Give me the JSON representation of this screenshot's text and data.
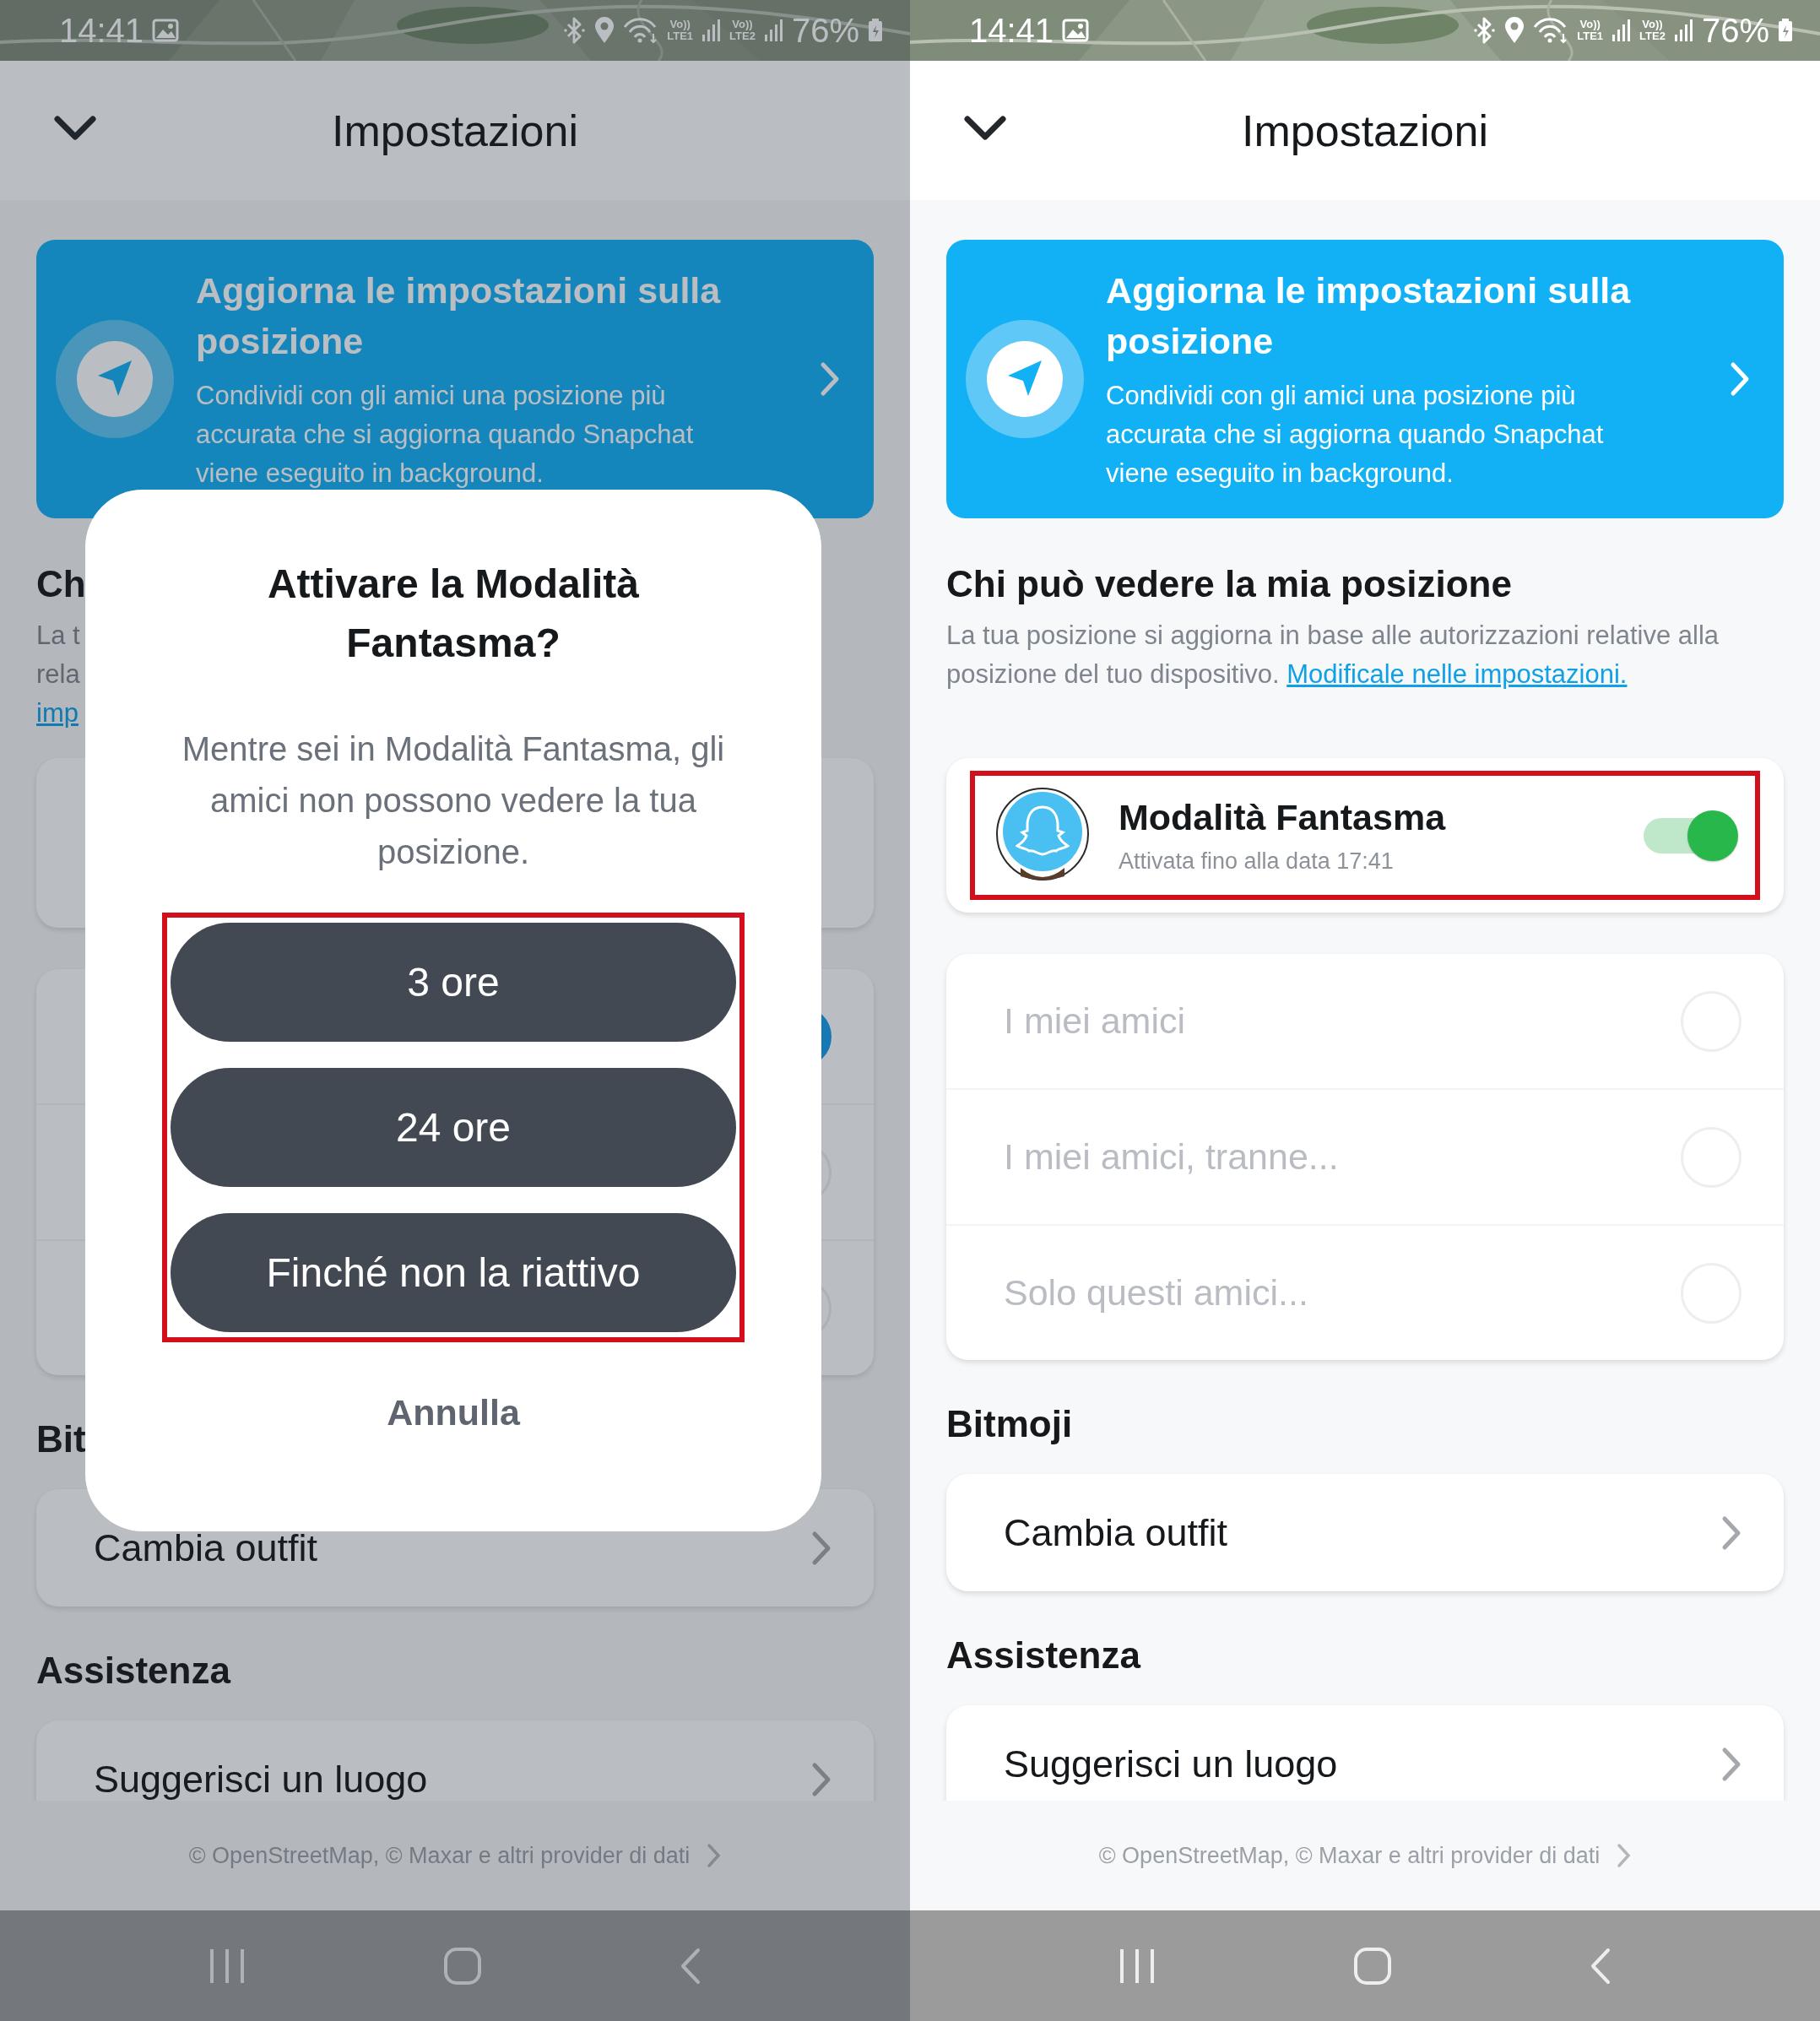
{
  "phones": [
    {
      "kind": "behind_dialog",
      "status_bar": {
        "time": "14:41",
        "sims": [
          {
            "voice": "Vo))",
            "network": "LTE1"
          },
          {
            "voice": "Vo))",
            "network": "LTE2"
          }
        ],
        "battery": "76%"
      },
      "header": {
        "title": "Impostazioni"
      },
      "banner": {
        "title": "Aggiorna le impostazioni sulla posizione",
        "body": "Condividi con gli amici una posizione più accurata che si aggiorna quando Snapchat viene eseguito in background."
      },
      "visibility": {
        "heading": "Ch",
        "description_fragments": [
          {
            "text": "La t",
            "kind": "plain"
          },
          {
            "text": "rela",
            "kind": "plain"
          },
          {
            "text": "imp",
            "kind": "link"
          }
        ],
        "options": [
          {
            "selected": true
          },
          {
            "selected": false
          },
          {
            "selected": false
          }
        ]
      },
      "bitmoji": {
        "heading": "Bit",
        "item": "Cambia outfit"
      },
      "support": {
        "heading": "Assistenza",
        "item": "Suggerisci un luogo"
      },
      "attribution": "© OpenStreetMap, © Maxar e altri provider di dati",
      "dialog": {
        "title": "Attivare la Modalità Fantasma?",
        "message": "Mentre sei in Modalità Fantasma, gli amici non possono vedere la tua posizione.",
        "options_highlighted": true,
        "options": [
          {
            "label": "3 ore"
          },
          {
            "label": "24 ore"
          },
          {
            "label": "Finché non la riattivo"
          }
        ],
        "cancel": "Annulla"
      }
    },
    {
      "kind": "full",
      "status_bar": {
        "time": "14:41",
        "sims": [
          {
            "voice": "Vo))",
            "network": "LTE1"
          },
          {
            "voice": "Vo))",
            "network": "LTE2"
          }
        ],
        "battery": "76%"
      },
      "header": {
        "title": "Impostazioni"
      },
      "banner": {
        "title": "Aggiorna le impostazioni sulla posizione",
        "body": "Condividi con gli amici una posizione più accurata che si aggiorna quando Snapchat viene eseguito in background."
      },
      "visibility": {
        "heading": "Chi può vedere la mia posizione",
        "description": "La tua posizione si aggiorna in base alle autorizzazioni relative alla posizione del tuo dispositivo.",
        "link": "Modificale nelle impostazioni.",
        "options": [
          {
            "label": "I miei amici",
            "selected": false,
            "disabled": true
          },
          {
            "label": "I miei amici, tranne...",
            "selected": false,
            "disabled": true
          },
          {
            "label": "Solo questi amici...",
            "selected": false,
            "disabled": true
          }
        ]
      },
      "ghost_mode": {
        "title": "Modalità Fantasma",
        "subtitle": "Attivata fino alla data 17:41",
        "on": true,
        "highlighted": true
      },
      "bitmoji": {
        "heading": "Bitmoji",
        "item": "Cambia outfit"
      },
      "support": {
        "heading": "Assistenza",
        "item": "Suggerisci un luogo"
      },
      "attribution": "© OpenStreetMap, © Maxar e altri provider di dati"
    }
  ]
}
